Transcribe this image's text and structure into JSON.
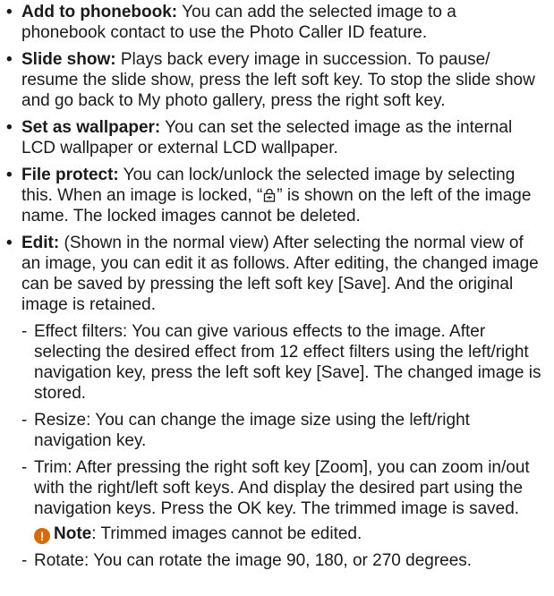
{
  "items": [
    {
      "term": "Add to phonebook:",
      "text": " You can add the selected image to a phonebook contact to use the Photo Caller ID feature."
    },
    {
      "term": "Slide show:",
      "text": " Plays back every image in succession. To pause/ resume the slide show, press the left soft key. To stop the slide show and go back to My photo gallery, press the right soft key."
    },
    {
      "term": "Set as wallpaper:",
      "text": " You can set the selected image as the internal LCD wallpaper or external LCD wallpaper."
    },
    {
      "term": "File protect:",
      "text_before": " You can lock/unlock the selected image by selecting this. When an image is locked, “",
      "text_after": "” is shown on the left of the image name. The locked images cannot be deleted.",
      "icon": "lock-icon"
    },
    {
      "term": "Edit:",
      "text": " (Shown in the normal view) After selecting the normal view of an image, you can edit it as follows. After editing, the changed image can be saved by pressing the left soft key [Save]. And the original image is retained."
    }
  ],
  "subitems": [
    {
      "dash": "-",
      "text": "Effect filters: You can give various effects to the image. After selecting the desired effect from 12 effect filters using the left/right navigation key, press the left soft key [Save]. The changed image is stored."
    },
    {
      "dash": "-",
      "text": "Resize: You can change the image size using the left/right navigation key."
    },
    {
      "dash": "-",
      "text": "Trim: After pressing the right soft key [Zoom], you can zoom in/out with the right/left soft keys. And display the desired part using the navigation keys. Press the OK key. The trimmed image is saved."
    },
    {
      "dash": "-",
      "text": "Rotate: You can rotate the image 90, 180, or 270 degrees."
    }
  ],
  "note": {
    "icon_glyph": "!",
    "label": "Note",
    "text": ": Trimmed images cannot be edited."
  },
  "bullet_glyph": "•",
  "colors": {
    "text": "#1a1a1a",
    "note_icon": "#d96a0b"
  }
}
